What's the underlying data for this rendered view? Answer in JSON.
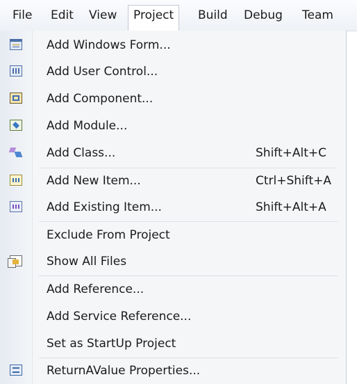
{
  "menubar": {
    "items": [
      "File",
      "Edit",
      "View",
      "Project",
      "Build",
      "Debug",
      "Team"
    ],
    "active": "Project"
  },
  "project_menu": {
    "groups": [
      [
        {
          "label": "Add Windows Form...",
          "shortcut": "",
          "icon": "windows-form-icon"
        },
        {
          "label": "Add User Control...",
          "shortcut": "",
          "icon": "user-control-icon"
        },
        {
          "label": "Add Component...",
          "shortcut": "",
          "icon": "component-icon"
        },
        {
          "label": "Add Module...",
          "shortcut": "",
          "icon": "module-icon"
        },
        {
          "label": "Add Class...",
          "shortcut": "Shift+Alt+C",
          "icon": "class-icon"
        }
      ],
      [
        {
          "label": "Add New Item...",
          "shortcut": "Ctrl+Shift+A",
          "icon": "new-item-icon"
        },
        {
          "label": "Add Existing Item...",
          "shortcut": "Shift+Alt+A",
          "icon": "existing-item-icon"
        }
      ],
      [
        {
          "label": "Exclude From Project",
          "shortcut": "",
          "icon": ""
        },
        {
          "label": "Show All Files",
          "shortcut": "",
          "icon": "show-all-files-icon"
        }
      ],
      [
        {
          "label": "Add Reference...",
          "shortcut": "",
          "icon": ""
        },
        {
          "label": "Add Service Reference...",
          "shortcut": "",
          "icon": ""
        },
        {
          "label": "Set as StartUp Project",
          "shortcut": "",
          "icon": ""
        }
      ],
      [
        {
          "label": "ReturnAValue Properties...",
          "shortcut": "",
          "icon": "properties-icon"
        }
      ]
    ]
  }
}
